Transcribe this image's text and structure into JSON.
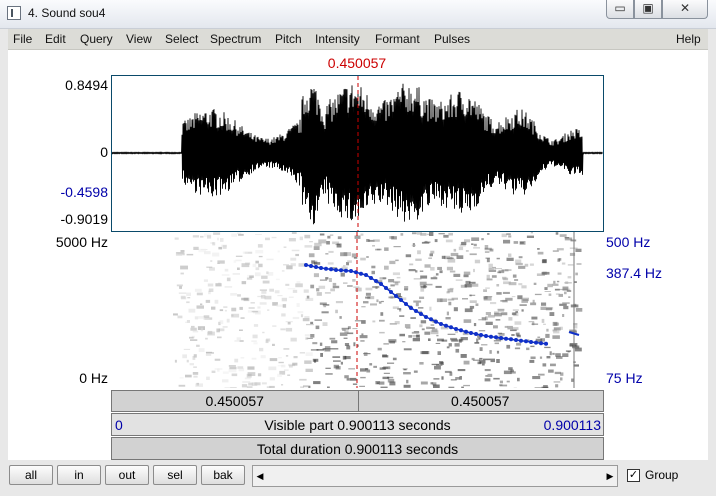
{
  "window": {
    "title": "4. Sound sou4",
    "minimize_label": "▭",
    "maximize_label": "▣",
    "close_label": "✕"
  },
  "menu": [
    "File",
    "Edit",
    "Query",
    "View",
    "Select",
    "Spectrum",
    "Pitch",
    "Intensity",
    "Formant",
    "Pulses",
    "Help"
  ],
  "cursor_time": "0.450057",
  "waveform": {
    "max": "0.8494",
    "zero": "0",
    "cursor_value": "-0.4598",
    "min": "-0.9019"
  },
  "spectrogram": {
    "freq_top": "5000 Hz",
    "freq_bottom": "0 Hz"
  },
  "pitch": {
    "top": "500 Hz",
    "cursor_value": "387.4 Hz",
    "bottom": "75 Hz"
  },
  "time_bars": {
    "left_segment": "0.450057",
    "right_segment": "0.450057",
    "visible_start": "0",
    "visible_label": "Visible part 0.900113 seconds",
    "visible_end": "0.900113",
    "total_label": "Total duration 0.900113 seconds"
  },
  "buttons": {
    "all": "all",
    "in": "in",
    "out": "out",
    "sel": "sel",
    "bak": "bak"
  },
  "scroll": {
    "left_arrow": "◀",
    "right_arrow": "▶"
  },
  "group": {
    "label": "Group",
    "checked": true,
    "check_mark": "✓"
  },
  "colors": {
    "cursor": "#cc0000",
    "pitch": "#1030c8",
    "axis_blue": "#0000aa"
  }
}
